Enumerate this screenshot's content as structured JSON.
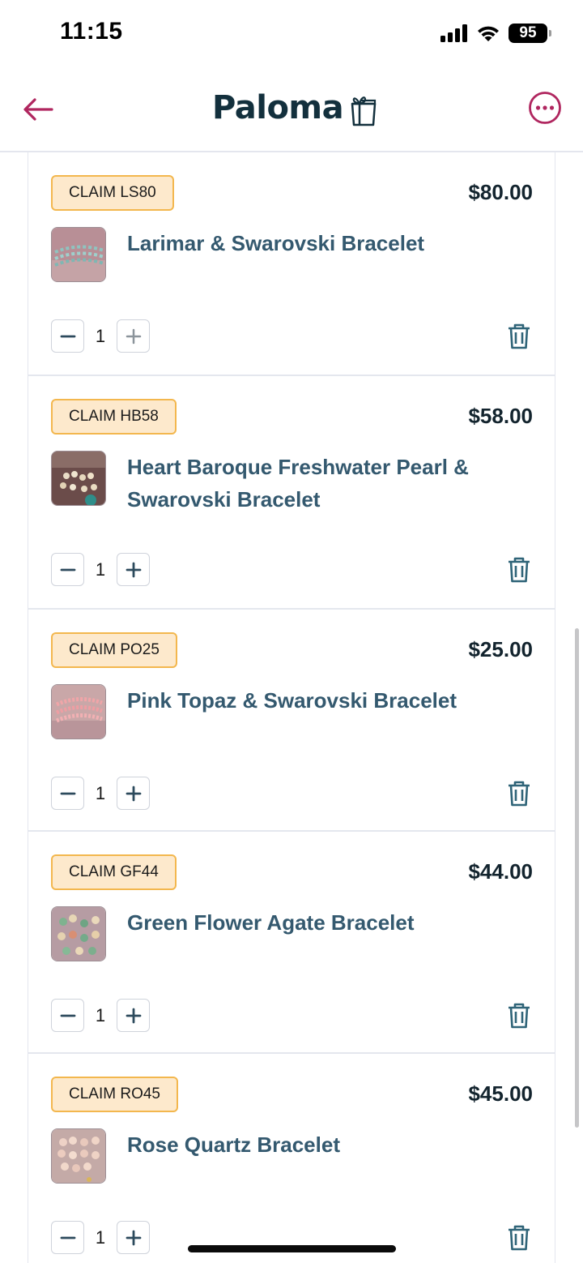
{
  "status_bar": {
    "time": "11:15",
    "battery": "95"
  },
  "header": {
    "title": "Paloma",
    "back_icon": "arrow-left-icon",
    "gift_icon": "gift-icon",
    "more_icon": "more-horizontal-icon"
  },
  "colors": {
    "accent": "#b0265f",
    "navy": "#13303d",
    "title_blue": "#34596f",
    "badge_bg": "#fde9cc",
    "badge_border": "#f3b74e"
  },
  "cart_items": [
    {
      "claim": "CLAIM LS80",
      "price": "$80.00",
      "title": "Larimar & Swarovski Bracelet",
      "qty": "1",
      "minus": "−",
      "plus": "+"
    },
    {
      "claim": "CLAIM HB58",
      "price": "$58.00",
      "title": "Heart Baroque Freshwater Pearl & Swarovski Bracelet",
      "qty": "1",
      "minus": "−",
      "plus": "+"
    },
    {
      "claim": "CLAIM PO25",
      "price": "$25.00",
      "title": "Pink Topaz & Swarovski Bracelet",
      "qty": "1",
      "minus": "−",
      "plus": "+"
    },
    {
      "claim": "CLAIM GF44",
      "price": "$44.00",
      "title": "Green Flower Agate Bracelet",
      "qty": "1",
      "minus": "−",
      "plus": "+"
    },
    {
      "claim": "CLAIM RO45",
      "price": "$45.00",
      "title": "Rose Quartz Bracelet",
      "qty": "1",
      "minus": "−",
      "plus": "+"
    }
  ]
}
